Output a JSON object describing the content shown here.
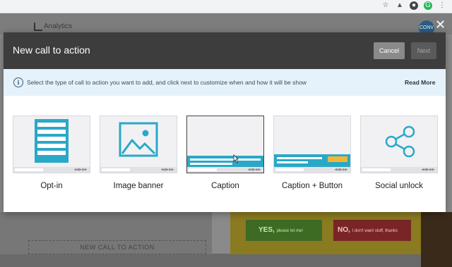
{
  "background": {
    "analytics_label": "Analytics",
    "avatar_text": "CONV",
    "close_glyph": "✕",
    "dropzone_label": "NEW CALL TO ACTION",
    "yes_label": "YES,",
    "yes_small": "please let me!",
    "no_label": "NO,",
    "no_small": "I don't want stuff, thanks"
  },
  "modal": {
    "title": "New call to action",
    "cancel_label": "Cancel",
    "next_label": "Next",
    "info_text": "Select the type of call to action you want to add, and click next to customize when and how it will be show",
    "read_more": "Read More",
    "info_icon": "i"
  },
  "options": [
    {
      "label": "Opt-in",
      "icon": "optin-form-icon"
    },
    {
      "label": "Image banner",
      "icon": "image-icon"
    },
    {
      "label": "Caption",
      "icon": "caption-icon",
      "selected": true
    },
    {
      "label": "Caption + Button",
      "icon": "caption-button-icon"
    },
    {
      "label": "Social unlock",
      "icon": "share-icon"
    }
  ],
  "player_controls": "◀◀ ▶ ▶▶",
  "colors": {
    "accent": "#2aa8c8",
    "caption_button": "#f2b632",
    "modal_header": "#3d3d3d",
    "info_bar": "#e5f2fb"
  }
}
